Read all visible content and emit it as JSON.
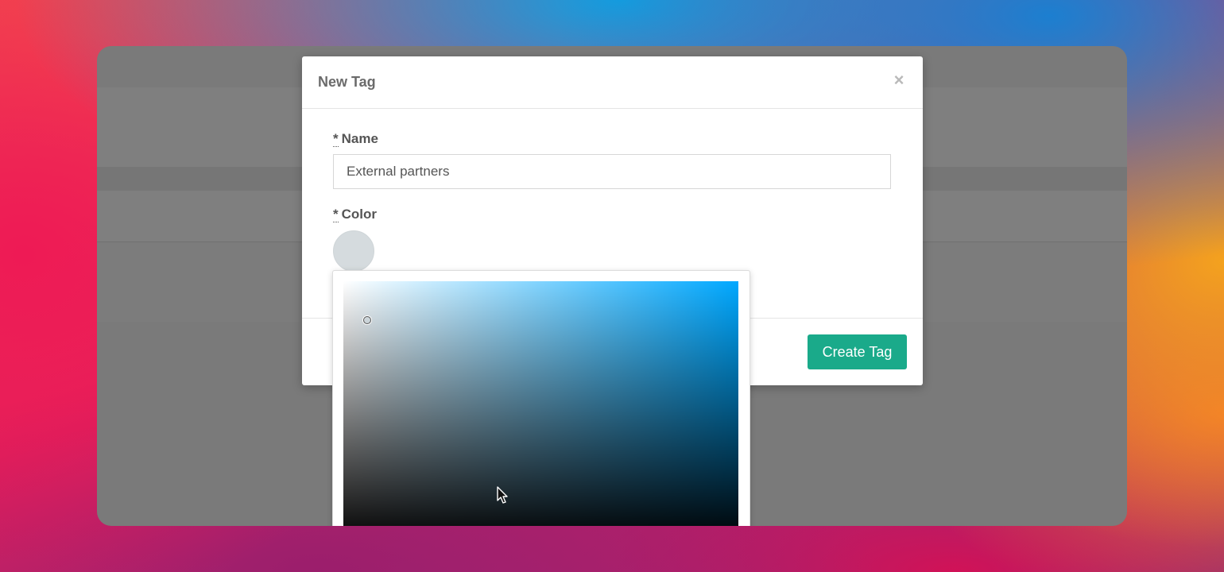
{
  "modal": {
    "title": "New Tag",
    "close_glyph": "×",
    "close_icon": "close-icon"
  },
  "form": {
    "required_marker": "*",
    "name_label": "Name",
    "name_value": "External partners",
    "color_label": "Color",
    "color_value": "#d5dbde"
  },
  "color_picker": {
    "hue_color": "#00a8ff"
  },
  "footer": {
    "create_label": "Create Tag",
    "create_color": "#1aaa8a"
  },
  "cursor": {
    "icon": "arrow-cursor-icon"
  }
}
